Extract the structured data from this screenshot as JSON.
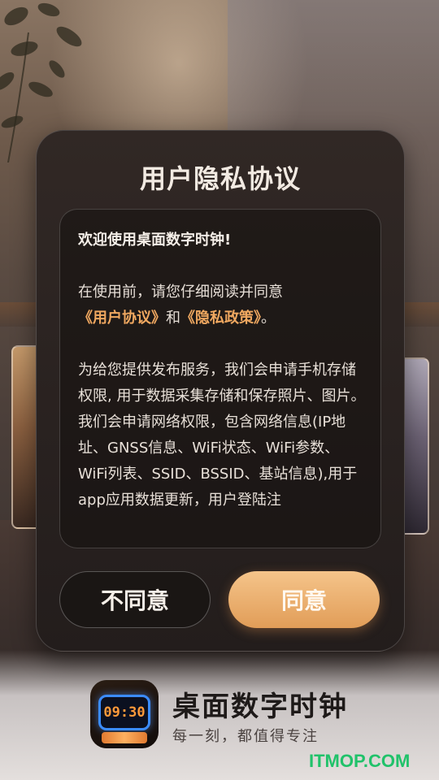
{
  "dialog": {
    "title": "用户隐私协议",
    "welcome": "欢迎使用桌面数字时钟!",
    "para1_prefix": "在使用前，请您仔细阅读并同意",
    "link_user_agreement": "《用户协议》",
    "para1_and": "和",
    "link_privacy_policy": "《隐私政策》",
    "para1_suffix": "。",
    "para2": "为给您提供发布服务，我们会申请手机存储权限, 用于数据采集存储和保存照片、图片。",
    "para3": "我们会申请网络权限，包含网络信息(IP地址、GNSS信息、WiFi状态、WiFi参数、WiFi列表、SSID、BSSID、基站信息),用于app应用数据更新，用户登陆注",
    "disagree_label": "不同意",
    "agree_label": "同意"
  },
  "app": {
    "icon_clock_text": "09:30",
    "name": "桌面数字时钟",
    "slogan": "每一刻，都值得专注"
  },
  "watermark": "ITMOP.COM",
  "colors": {
    "accent": "#e8a562",
    "link": "#f0a860",
    "dialog_bg": "#2a2220",
    "watermark": "#20c26a"
  }
}
